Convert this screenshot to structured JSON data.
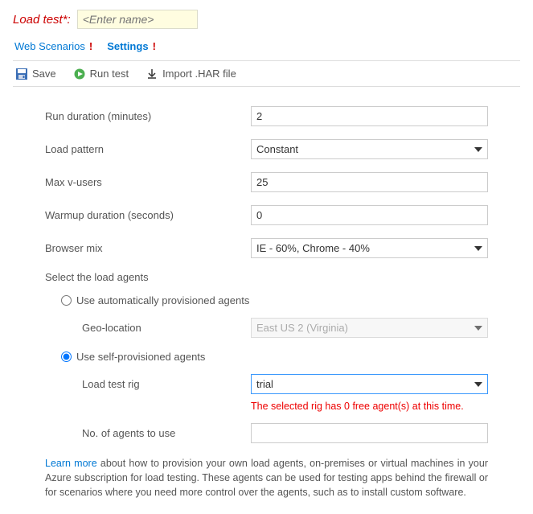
{
  "header": {
    "title_label": "Load test*:",
    "name_placeholder": "<Enter name>"
  },
  "tabs": {
    "web_scenarios": "Web Scenarios",
    "settings": "Settings",
    "bang": "!"
  },
  "toolbar": {
    "save": "Save",
    "run": "Run test",
    "import": "Import .HAR file"
  },
  "form": {
    "run_duration": {
      "label": "Run duration (minutes)",
      "value": "2"
    },
    "load_pattern": {
      "label": "Load pattern",
      "value": "Constant"
    },
    "max_vusers": {
      "label": "Max v-users",
      "value": "25"
    },
    "warmup": {
      "label": "Warmup duration (seconds)",
      "value": "0"
    },
    "browser_mix": {
      "label": "Browser mix",
      "value": "IE - 60%, Chrome - 40%"
    },
    "agents_label": "Select the load agents",
    "auto_agents": "Use automatically provisioned agents",
    "geo": {
      "label": "Geo-location",
      "value": "East US 2 (Virginia)"
    },
    "self_agents": "Use self-provisioned agents",
    "rig": {
      "label": "Load test rig",
      "value": "trial"
    },
    "rig_warning": "The selected rig has 0 free agent(s) at this time.",
    "num_agents": {
      "label": "No. of agents to use",
      "value": ""
    }
  },
  "footer": {
    "learn_more": "Learn more",
    "text": " about how to provision your own load agents, on-premises or virtual machines in your Azure subscription for load testing. These agents can be used for testing apps behind the firewall or for scenarios where you need more control over the agents, such as to install custom software."
  }
}
